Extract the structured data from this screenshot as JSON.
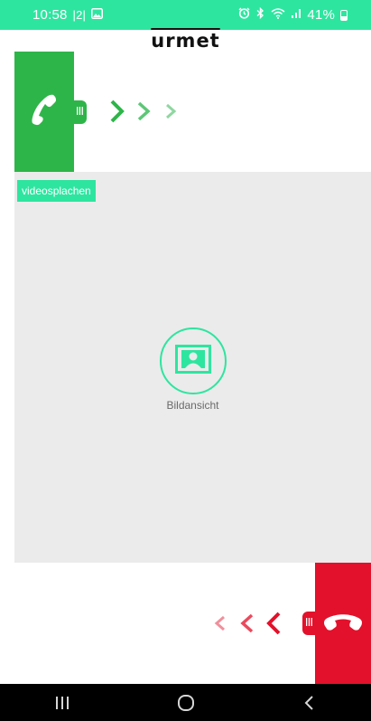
{
  "status_bar": {
    "time": "10:58",
    "separator": "|2|",
    "battery_percent": "41%",
    "icons": [
      "gallery-icon",
      "alarm-icon",
      "bluetooth-icon",
      "wifi-icon",
      "signal-icon",
      "battery-icon"
    ]
  },
  "header": {
    "logo": "urmet"
  },
  "colors": {
    "accent": "#2ee5a0",
    "accept": "#2eb549",
    "hangup": "#e3112b",
    "video_bg": "#ebebeb"
  },
  "video": {
    "tag": "videosplachen",
    "image_view_label": "Bildansicht"
  },
  "accept_control": {
    "icon": "phone-icon",
    "handle_icon": "grip-icon",
    "arrows": 3
  },
  "hangup_control": {
    "icon": "hangup-icon",
    "handle_icon": "grip-icon",
    "arrows": 3
  },
  "nav_bar": {
    "buttons": [
      "recents-icon",
      "home-icon",
      "back-icon"
    ]
  }
}
